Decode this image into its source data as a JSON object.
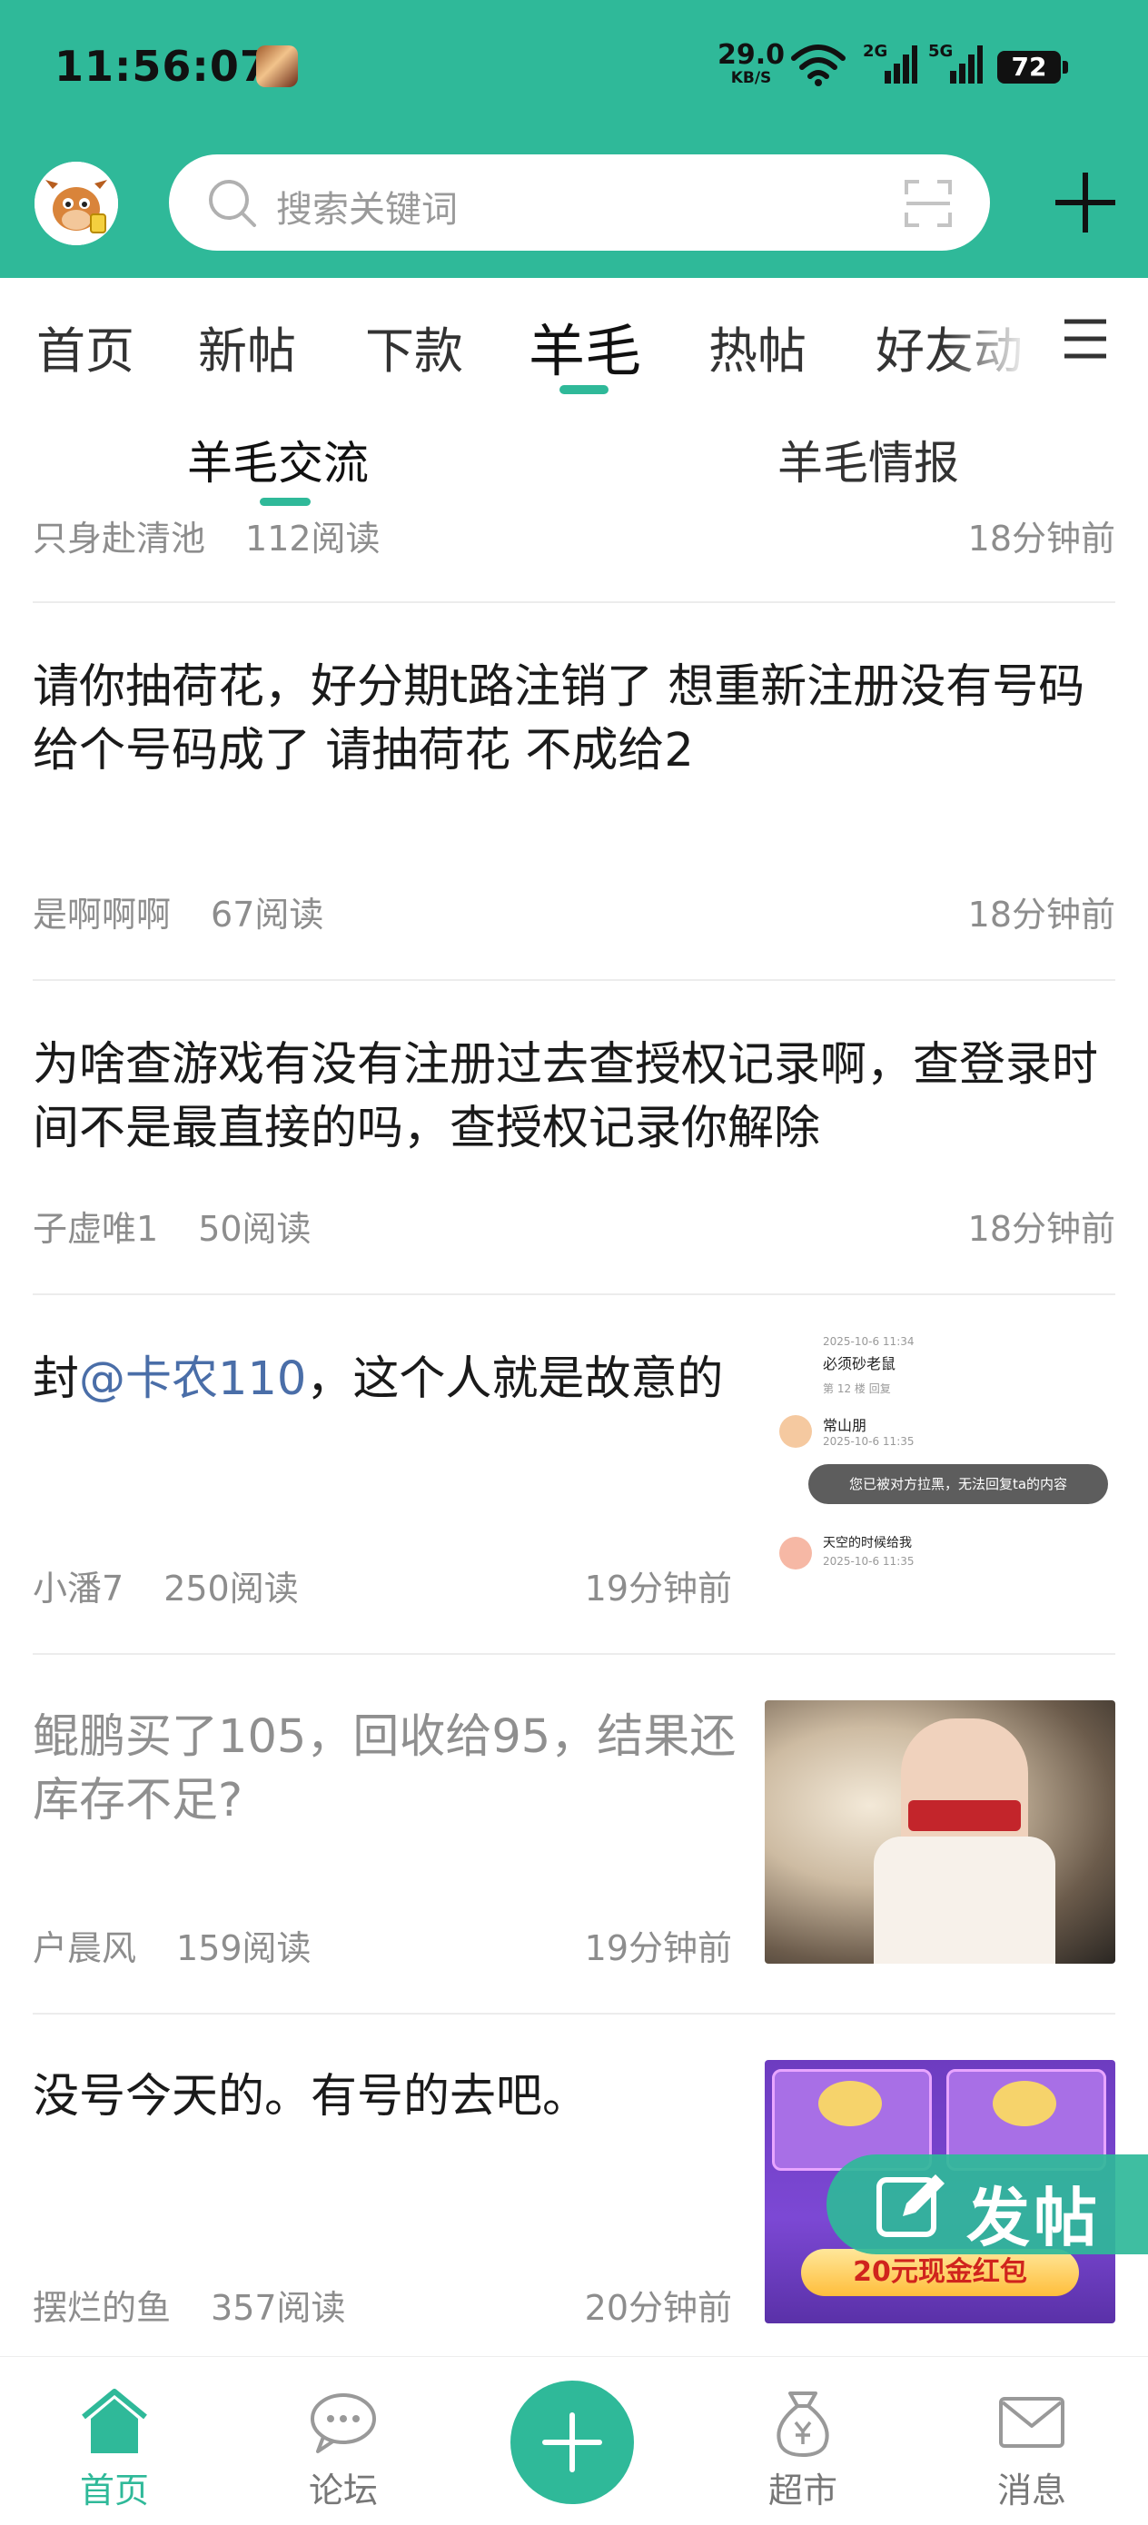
{
  "status_bar": {
    "time": "11:56:07",
    "net_speed_value": "29.0",
    "net_speed_unit": "KB/S",
    "signal_1": "2G",
    "signal_2": "5G",
    "battery": "72"
  },
  "header": {
    "search_placeholder": "搜索关键词",
    "accent_color": "#2fb999"
  },
  "tabs": {
    "items": [
      "首页",
      "新帖",
      "下款",
      "羊毛",
      "热帖",
      "好友动"
    ],
    "active_index": 3
  },
  "subtabs": {
    "items": [
      "羊毛交流",
      "羊毛情报"
    ],
    "active_index": 0
  },
  "feed": {
    "posts": [
      {
        "author": "只身赴清池",
        "reads": "112阅读",
        "time": "18分钟前"
      },
      {
        "title": "请你抽荷花，好分期t路注销了 想重新注册没有号码 给个号码成了 请抽荷花 不成给2",
        "author": "是啊啊啊",
        "reads": "67阅读",
        "time": "18分钟前"
      },
      {
        "title": "为啥查游戏有没有注册过去查授权记录啊，查登录时间不是最直接的吗，查授权记录你解除",
        "author": "子虚唯1",
        "reads": "50阅读",
        "time": "18分钟前"
      },
      {
        "title_pre": "封",
        "title_mention": "@卡农110",
        "title_post": "，这个人就是故意的",
        "author": "小潘7",
        "reads": "250阅读",
        "time": "19分钟前",
        "thumb": {
          "line1": "必须砂老鼠",
          "line1_meta": "第 12 楼  回复",
          "user": "常山朋",
          "date": "2025-10-6 11:35",
          "toast": "您已被对方拉黑，无法回复ta的内容",
          "user2": "天空的时候给我",
          "date2": "2025-10-6 11:35",
          "top": "2025-10-6 11:34"
        }
      },
      {
        "title": "鲲鹏买了105，回收给95，结果还库存不足?",
        "author": "户晨风",
        "reads": "159阅读",
        "time": "19分钟前"
      },
      {
        "title": "没号今天的。有号的去吧。",
        "author": "摆烂的鱼",
        "reads": "357阅读",
        "time": "20分钟前",
        "thumb": {
          "banner": "20元现金红包",
          "card_text": "进送游戏下载专属"
        }
      }
    ]
  },
  "fab": {
    "label": "发帖"
  },
  "bottom_nav": {
    "items": [
      "首页",
      "论坛",
      "超市",
      "消息"
    ],
    "active_index": 0
  }
}
